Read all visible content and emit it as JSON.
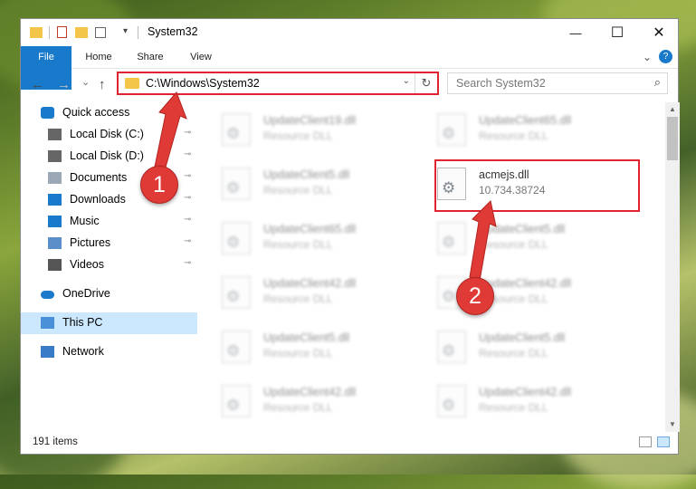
{
  "window": {
    "title": "System32",
    "minimize_glyph": "—",
    "maximize_glyph": "☐",
    "close_glyph": "✕"
  },
  "ribbon": {
    "tabs": [
      "File",
      "Home",
      "Share",
      "View"
    ],
    "help_glyph": "?",
    "expand_glyph": "⌄"
  },
  "navigation": {
    "back_glyph": "←",
    "forward_glyph": "→",
    "recent_glyph": "⌄",
    "up_glyph": "↑"
  },
  "address_bar": {
    "path": "C:\\Windows\\System32",
    "dropdown_glyph": "⌄",
    "refresh_glyph": "↻"
  },
  "search": {
    "placeholder": "Search System32",
    "icon": "search-icon",
    "glyph": "⌕"
  },
  "nav_pane": {
    "items": [
      {
        "label": "Quick access",
        "icon": "star-icon",
        "pinned": false
      },
      {
        "label": "Local Disk (C:)",
        "icon": "drive-icon",
        "pinned": true
      },
      {
        "label": "Local Disk (D:)",
        "icon": "drive-icon",
        "pinned": true
      },
      {
        "label": "Documents",
        "icon": "documents-icon",
        "pinned": true
      },
      {
        "label": "Downloads",
        "icon": "download-icon",
        "pinned": true
      },
      {
        "label": "Music",
        "icon": "music-icon",
        "pinned": true
      },
      {
        "label": "Pictures",
        "icon": "pictures-icon",
        "pinned": true
      },
      {
        "label": "Videos",
        "icon": "videos-icon",
        "pinned": true
      },
      {
        "label": "OneDrive",
        "icon": "cloud-icon",
        "pinned": false
      },
      {
        "label": "This PC",
        "icon": "computer-icon",
        "pinned": false,
        "selected": true
      },
      {
        "label": "Network",
        "icon": "network-icon",
        "pinned": false
      }
    ],
    "pin_glyph": "📌"
  },
  "files": [
    {
      "name": "UpdateClient19.dll",
      "subtitle": "Resource DLL",
      "blurred": true
    },
    {
      "name": "UpdateClient65.dll",
      "subtitle": "Resource DLL",
      "blurred": true
    },
    {
      "name": "UpdateClient5.dll",
      "subtitle": "Resource DLL",
      "blurred": true
    },
    {
      "name": "acmejs.dll",
      "subtitle": "10.734.38724",
      "blurred": false,
      "highlighted": true
    },
    {
      "name": "UpdateClient65.dll",
      "subtitle": "Resource DLL",
      "blurred": true
    },
    {
      "name": "UpdateClient5.dll",
      "subtitle": "Resource DLL",
      "blurred": true
    },
    {
      "name": "UpdateClient42.dll",
      "subtitle": "Resource DLL",
      "blurred": true
    },
    {
      "name": "UpdateClient42.dll",
      "subtitle": "Resource DLL",
      "blurred": true
    },
    {
      "name": "UpdateClient5.dll",
      "subtitle": "Resource DLL",
      "blurred": true
    },
    {
      "name": "UpdateClient5.dll",
      "subtitle": "Resource DLL",
      "blurred": true
    },
    {
      "name": "UpdateClient42.dll",
      "subtitle": "Resource DLL",
      "blurred": true
    },
    {
      "name": "UpdateClient42.dll",
      "subtitle": "Resource DLL",
      "blurred": true
    }
  ],
  "status_bar": {
    "item_count": "191 items"
  },
  "annotations": {
    "callout_1": "1",
    "callout_2": "2",
    "highlight_color": "#e0232e",
    "callout_color": "#e03a36"
  },
  "colors": {
    "accent": "#1979ca",
    "selection": "#cce8ff",
    "folder": "#f3c64a"
  }
}
